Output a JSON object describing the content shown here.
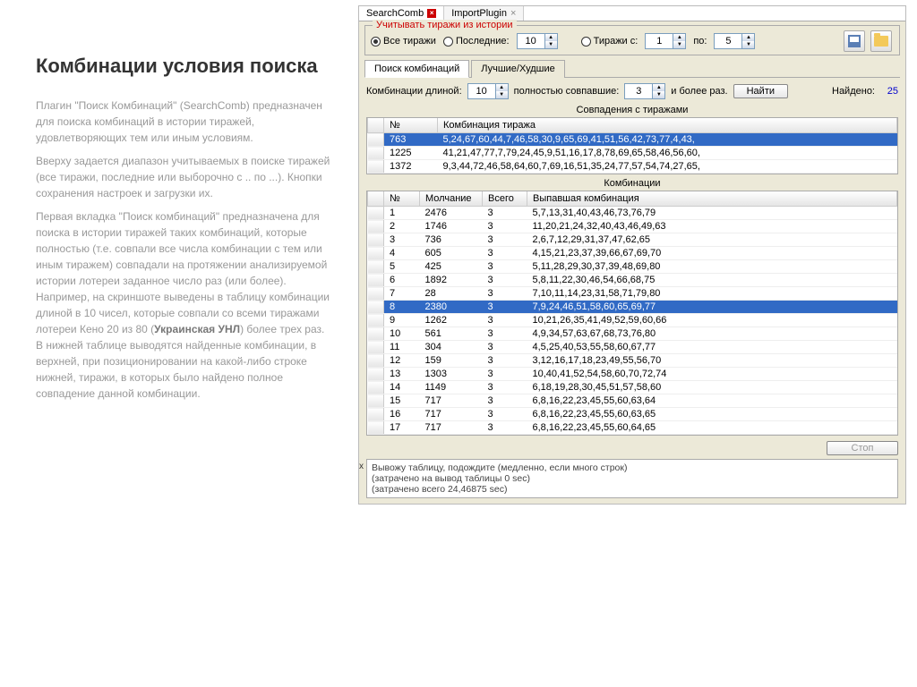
{
  "left": {
    "title": "Комбинации условия поиска",
    "p1": "Плагин \"Поиск Комбинаций\" (SearchComb) предназначен для поиска комбинаций в истории тиражей, удовлетворяющих тем или иным условиям.",
    "p2": "Вверху задается диапазон учитываемых в поиске тиражей (все тиражи, последние или выборочно с .. по ...). Кнопки сохранения настроек и загрузки их.",
    "p3_a": "Первая вкладка \"Поиск комбинаций\" предназначена для поиска в истории тиражей таких комбинаций, которые полностью (т.е. совпали все числа комбинации с тем или иным тиражем) совпадали на протяжении анализируемой истории лотереи заданное число раз (или более). Например, на скриншоте выведены в таблицу комбинации длиной в 10 чисел, которые совпали со всеми тиражами лотереи Кено 20 из 80 (",
    "p3_link": "Украинская УНЛ",
    "p3_b": ") более трех раз. В нижней таблице выводятся найденные комбинации, в верхней, при позиционировании на какой-либо строке нижней, тиражи, в которых было найдено полное совпадение данной комбинации."
  },
  "tabs": {
    "t1": "SearchComb",
    "t2": "ImportPlugin"
  },
  "group": {
    "title": "Учитывать тиражи из истории",
    "all": "Все тиражи",
    "last": "Последние:",
    "from": "Тиражи с:",
    "to": "по:",
    "last_val": "10",
    "from_val": "1",
    "to_val": "5"
  },
  "subtabs": {
    "s1": "Поиск комбинаций",
    "s2": "Лучшие/Худшие"
  },
  "params": {
    "len_label": "Комбинации длиной:",
    "len_val": "10",
    "match_label": "полностью совпавшие:",
    "match_val": "3",
    "more": "и более раз.",
    "find": "Найти",
    "found_label": "Найдено:",
    "found_val": "25"
  },
  "top_table": {
    "title": "Совпадения с тиражами",
    "h1": "№",
    "h2": "Комбинация тиража",
    "rows": [
      {
        "n": "763",
        "c": "5,24,67,60,44,7,46,58,30,9,65,69,41,51,56,42,73,77,4,43,"
      },
      {
        "n": "1225",
        "c": "41,21,47,77,7,79,24,45,9,51,16,17,8,78,69,65,58,46,56,60,"
      },
      {
        "n": "1372",
        "c": "9,3,44,72,46,58,64,60,7,69,16,51,35,24,77,57,54,74,27,65,"
      }
    ]
  },
  "bottom_table": {
    "title": "Комбинации",
    "h1": "№",
    "h2": "Молчание",
    "h3": "Всего",
    "h4": "Выпавшая комбинация",
    "rows": [
      {
        "n": "1",
        "m": "2476",
        "t": "3",
        "c": "5,7,13,31,40,43,46,73,76,79"
      },
      {
        "n": "2",
        "m": "1746",
        "t": "3",
        "c": "11,20,21,24,32,40,43,46,49,63"
      },
      {
        "n": "3",
        "m": "736",
        "t": "3",
        "c": "2,6,7,12,29,31,37,47,62,65"
      },
      {
        "n": "4",
        "m": "605",
        "t": "3",
        "c": "4,15,21,23,37,39,66,67,69,70"
      },
      {
        "n": "5",
        "m": "425",
        "t": "3",
        "c": "5,11,28,29,30,37,39,48,69,80"
      },
      {
        "n": "6",
        "m": "1892",
        "t": "3",
        "c": "5,8,11,22,30,46,54,66,68,75"
      },
      {
        "n": "7",
        "m": "28",
        "t": "3",
        "c": "7,10,11,14,23,31,58,71,79,80"
      },
      {
        "n": "8",
        "m": "2380",
        "t": "3",
        "c": "7,9,24,46,51,58,60,65,69,77"
      },
      {
        "n": "9",
        "m": "1262",
        "t": "3",
        "c": "10,21,26,35,41,49,52,59,60,66"
      },
      {
        "n": "10",
        "m": "561",
        "t": "3",
        "c": "4,9,34,57,63,67,68,73,76,80"
      },
      {
        "n": "11",
        "m": "304",
        "t": "3",
        "c": "4,5,25,40,53,55,58,60,67,77"
      },
      {
        "n": "12",
        "m": "159",
        "t": "3",
        "c": "3,12,16,17,18,23,49,55,56,70"
      },
      {
        "n": "13",
        "m": "1303",
        "t": "3",
        "c": "10,40,41,52,54,58,60,70,72,74"
      },
      {
        "n": "14",
        "m": "1149",
        "t": "3",
        "c": "6,18,19,28,30,45,51,57,58,60"
      },
      {
        "n": "15",
        "m": "717",
        "t": "3",
        "c": "6,8,16,22,23,45,55,60,63,64"
      },
      {
        "n": "16",
        "m": "717",
        "t": "3",
        "c": "6,8,16,22,23,45,55,60,63,65"
      },
      {
        "n": "17",
        "m": "717",
        "t": "3",
        "c": "6,8,16,22,23,45,55,60,64,65"
      }
    ]
  },
  "stop": "Стоп",
  "log": {
    "l1": "Вывожу таблицу, подождите (медленно, если много строк)",
    "l2": "(затрачено на вывод таблицы 0 sec)",
    "l3": "(затрачено всего 24,46875 sec)"
  }
}
